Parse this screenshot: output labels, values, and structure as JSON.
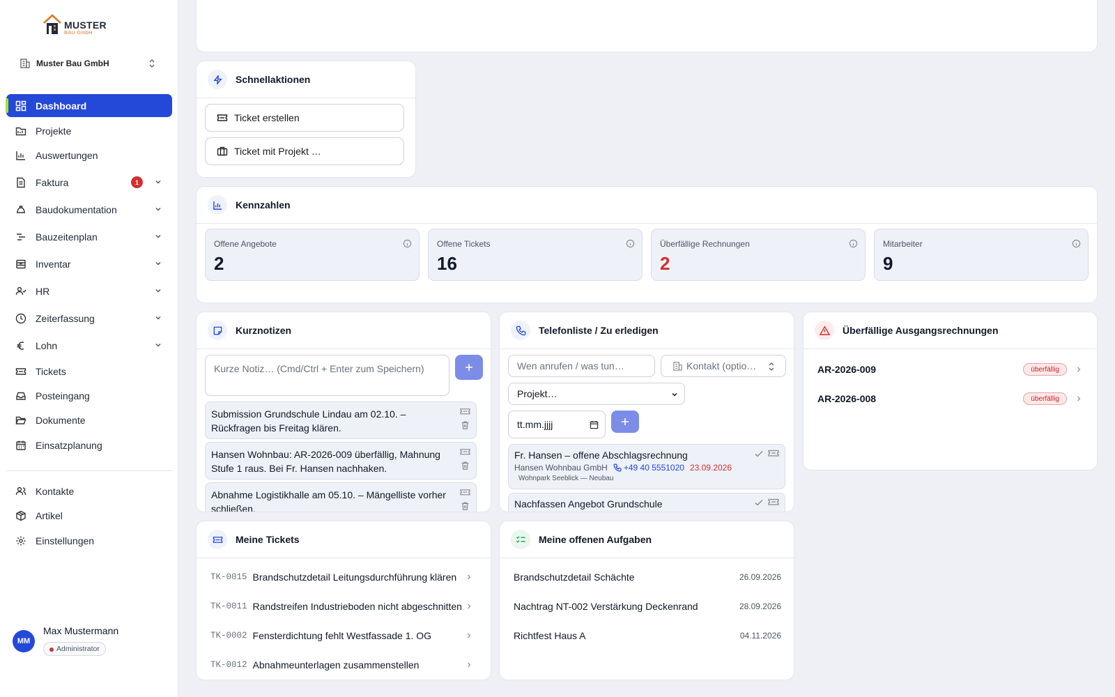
{
  "logo": {
    "main": "MUSTER",
    "sub": "BAU GmbH"
  },
  "company": "Muster Bau GmbH",
  "nav": [
    {
      "label": "Dashboard",
      "icon": "dashboard-icon"
    },
    {
      "label": "Projekte",
      "icon": "folder-icon"
    },
    {
      "label": "Auswertungen",
      "icon": "chart-icon"
    },
    {
      "label": "Faktura",
      "icon": "invoice-icon",
      "badge": "1"
    },
    {
      "label": "Baudokumentation",
      "icon": "helmet-icon"
    },
    {
      "label": "Bauzeitenplan",
      "icon": "timeline-icon"
    },
    {
      "label": "Inventar",
      "icon": "inventory-icon"
    },
    {
      "label": "HR",
      "icon": "users-icon"
    },
    {
      "label": "Zeiterfassung",
      "icon": "clock-icon"
    },
    {
      "label": "Lohn",
      "icon": "euro-icon"
    },
    {
      "label": "Tickets",
      "icon": "ticket-icon"
    },
    {
      "label": "Posteingang",
      "icon": "inbox-icon"
    },
    {
      "label": "Dokumente",
      "icon": "folder-open-icon"
    },
    {
      "label": "Einsatzplanung",
      "icon": "calendar-icon"
    },
    {
      "label": "Kontakte",
      "icon": "contacts-icon"
    },
    {
      "label": "Artikel",
      "icon": "package-icon"
    },
    {
      "label": "Einstellungen",
      "icon": "gear-icon"
    }
  ],
  "user": {
    "initials": "MM",
    "name": "Max Mustermann",
    "role": "Administrator"
  },
  "quick_actions": {
    "title": "Schnellaktionen",
    "buttons": [
      "Ticket erstellen",
      "Ticket mit Projekt …"
    ]
  },
  "kpis": {
    "title": "Kennzahlen",
    "items": [
      {
        "label": "Offene Angebote",
        "value": "2"
      },
      {
        "label": "Offene Tickets",
        "value": "16"
      },
      {
        "label": "Überfällige Rechnungen",
        "value": "2"
      },
      {
        "label": "Mitarbeiter",
        "value": "9"
      }
    ]
  },
  "notes": {
    "title": "Kurznotizen",
    "placeholder": "Kurze Notiz… (Cmd/Ctrl + Enter zum Speichern)",
    "items": [
      "Submission Grundschule Lindau am 02.10. – Rückfragen bis Freitag klären.",
      "Hansen Wohnbau: AR-2026-009 überfällig, Mahnung Stufe 1 raus. Bei Fr. Hansen nachhaken.",
      "Abnahme Logistikhalle am 05.10. – Mängelliste vorher schließen."
    ]
  },
  "phone": {
    "title": "Telefonliste / Zu erledigen",
    "what_placeholder": "Wen anrufen / was tun…",
    "contact_placeholder": "Kontakt (optio…",
    "project_select": "Projekt…",
    "date_placeholder": "tt.mm.jjjj",
    "items": [
      {
        "title": "Fr. Hansen – offene Abschlagsrechnung",
        "company": "Hansen Wohnbau GmbH",
        "phone": "+49 40 5551020",
        "date": "23.09.2026",
        "project": "Wohnpark Seeblick — Neubau"
      },
      {
        "title": "Nachfassen Angebot Grundschule"
      }
    ]
  },
  "overdue": {
    "title": "Überfällige Ausgangsrechnungen",
    "items": [
      {
        "number": "AR-2026-009",
        "status": "überfällig"
      },
      {
        "number": "AR-2026-008",
        "status": "überfällig"
      }
    ]
  },
  "tickets": {
    "title": "Meine Tickets",
    "items": [
      {
        "id": "TK-0015",
        "title": "Brandschutzdetail Leitungsdurchführung klären"
      },
      {
        "id": "TK-0011",
        "title": "Randstreifen Industrieboden nicht abgeschnitten"
      },
      {
        "id": "TK-0002",
        "title": "Fensterdichtung fehlt Westfassade 1. OG"
      },
      {
        "id": "TK-0012",
        "title": "Abnahmeunterlagen zusammenstellen"
      }
    ]
  },
  "tasks": {
    "title": "Meine offenen Aufgaben",
    "items": [
      {
        "title": "Brandschutzdetail Schächte",
        "date": "26.09.2026"
      },
      {
        "title": "Nachtrag NT-002 Verstärkung Deckenrand",
        "date": "28.09.2026"
      },
      {
        "title": "Richtfest Haus A",
        "date": "04.11.2026"
      }
    ]
  },
  "colors": {
    "accent": "#2448d8",
    "danger": "#d32f2f",
    "add_button": "#7c8de8",
    "background": "#eef0f5"
  }
}
